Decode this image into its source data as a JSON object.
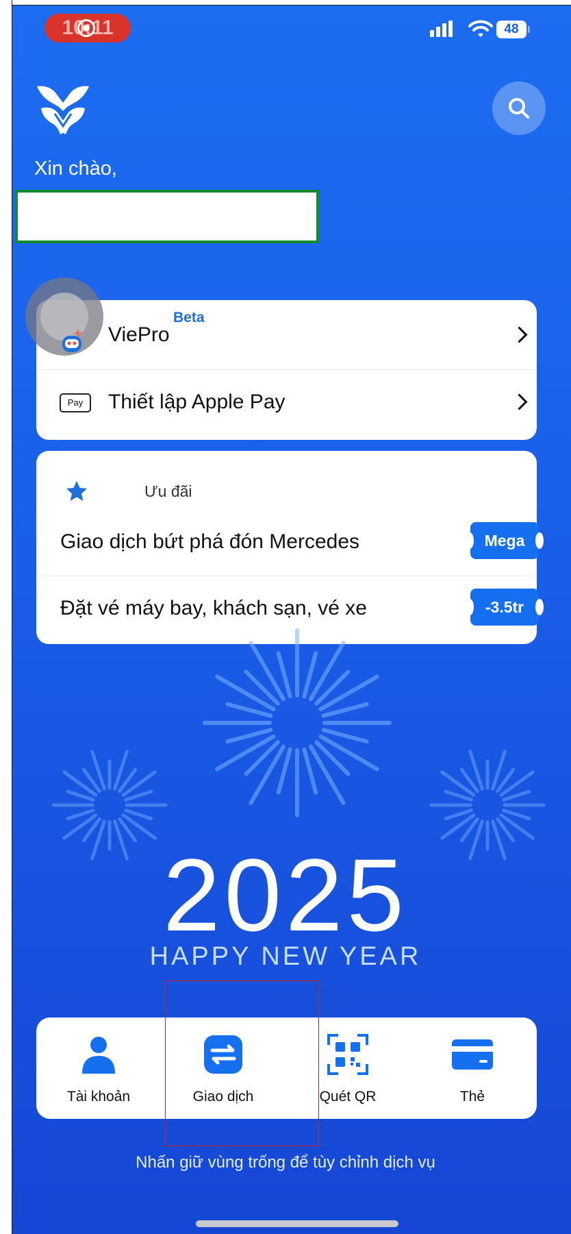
{
  "status_bar": {
    "time": "10:11",
    "battery": "48",
    "recording": true
  },
  "header": {
    "logo": "vietinbank-logo",
    "search_icon": "search-icon",
    "greeting": "Xin chào,"
  },
  "quick_actions": [
    {
      "label": "ViePro",
      "badge": "Beta",
      "icon": "robot-icon"
    },
    {
      "label": "Thiết lập Apple Pay",
      "icon": "apple-pay-icon",
      "icon_text": "Pay"
    }
  ],
  "offers": {
    "title": "Ưu đãi",
    "icon": "star-icon",
    "items": [
      {
        "label": "Giao dịch bứt phá đón Mercedes",
        "badge": "Mega"
      },
      {
        "label": "Đặt vé máy bay, khách sạn, vé xe",
        "badge": "-3.5tr"
      }
    ]
  },
  "banner": {
    "year": "2025",
    "tagline": "HAPPY NEW YEAR"
  },
  "dock": [
    {
      "label": "Tài khoản",
      "icon": "person-icon"
    },
    {
      "label": "Giao dịch",
      "icon": "transfer-icon"
    },
    {
      "label": "Quét QR",
      "icon": "qr-scan-icon"
    },
    {
      "label": "Thẻ",
      "icon": "card-icon"
    }
  ],
  "hint": "Nhấn giữ vùng trống để tùy chỉnh dịch vụ",
  "colors": {
    "background_top": "#1d6df0",
    "background_bottom": "#1547d4",
    "accent": "#1570f0",
    "card": "#ffffff"
  }
}
